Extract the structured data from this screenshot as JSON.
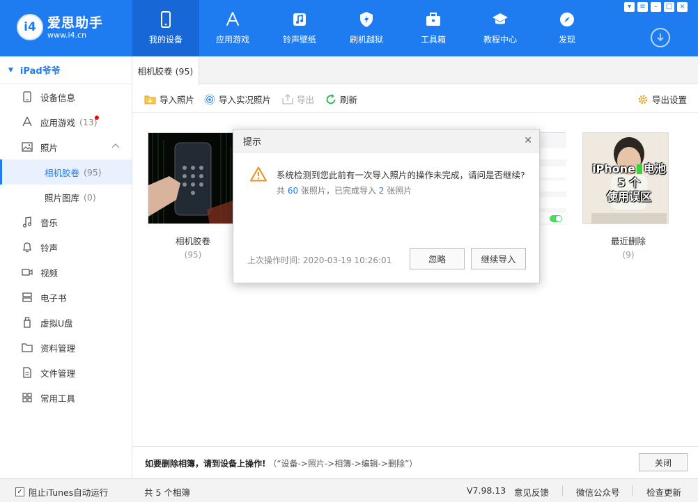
{
  "app": {
    "logo_badge": "i4",
    "logo_name": "爱思助手",
    "logo_url": "www.i4.cn",
    "brand_color": "#1f7cf0"
  },
  "nav": [
    {
      "label": "我的设备",
      "icon": "phone-icon"
    },
    {
      "label": "应用游戏",
      "icon": "app-store-icon"
    },
    {
      "label": "铃声壁纸",
      "icon": "music-icon"
    },
    {
      "label": "刷机越狱",
      "icon": "shield-icon"
    },
    {
      "label": "工具箱",
      "icon": "toolbox-icon"
    },
    {
      "label": "教程中心",
      "icon": "graduation-cap-icon"
    },
    {
      "label": "发现",
      "icon": "compass-icon"
    }
  ],
  "sidebar": {
    "device": "iPad爷爷",
    "items": [
      {
        "label": "设备信息",
        "count": ""
      },
      {
        "label": "应用游戏",
        "count": "(13)"
      },
      {
        "label": "照片",
        "count": ""
      },
      {
        "label": "相机胶卷",
        "count": "(95)"
      },
      {
        "label": "照片图库",
        "count": "(0)"
      },
      {
        "label": "音乐",
        "count": ""
      },
      {
        "label": "铃声",
        "count": ""
      },
      {
        "label": "视频",
        "count": ""
      },
      {
        "label": "电子书",
        "count": ""
      },
      {
        "label": "虚拟U盘",
        "count": ""
      },
      {
        "label": "资料管理",
        "count": ""
      },
      {
        "label": "文件管理",
        "count": ""
      },
      {
        "label": "常用工具",
        "count": ""
      }
    ]
  },
  "tab": {
    "label": "相机胶卷 (95)"
  },
  "toolbar": {
    "import_photos": "导入照片",
    "import_live": "导入实况照片",
    "export": "导出",
    "refresh": "刷新",
    "export_settings": "导出设置"
  },
  "albums": [
    {
      "name": "相机胶卷",
      "count": "(95)"
    },
    {
      "name": "最近删除",
      "count": "(9)",
      "thumb_text_1": "iPhone",
      "thumb_text_2": "电池",
      "thumb_text_3": "5 个",
      "thumb_text_4": "使用误区"
    }
  ],
  "bottom": {
    "note_bold": "如要删除相簿，请到设备上操作!",
    "note_rest": "（“设备->照片->相簿->编辑->删除”）",
    "close": "关闭"
  },
  "status": {
    "block_itunes": "阻止iTunes自动运行",
    "album_count": "共 5 个相簿",
    "version": "V7.98.13",
    "feedback": "意见反馈",
    "wechat": "微信公众号",
    "check_update": "检查更新"
  },
  "modal": {
    "title": "提示",
    "message": "系统检测到您此前有一次导入照片的操作未完成，请问是否继续?",
    "sub_prefix": "共",
    "total": "60",
    "sub_mid": "张照片，已完成导入",
    "done": "2",
    "sub_suffix": "张照片",
    "last_time_label": "上次操作时间:",
    "last_time": "2020-03-19 10:26:01",
    "ignore": "忽略",
    "continue": "继续导入"
  }
}
